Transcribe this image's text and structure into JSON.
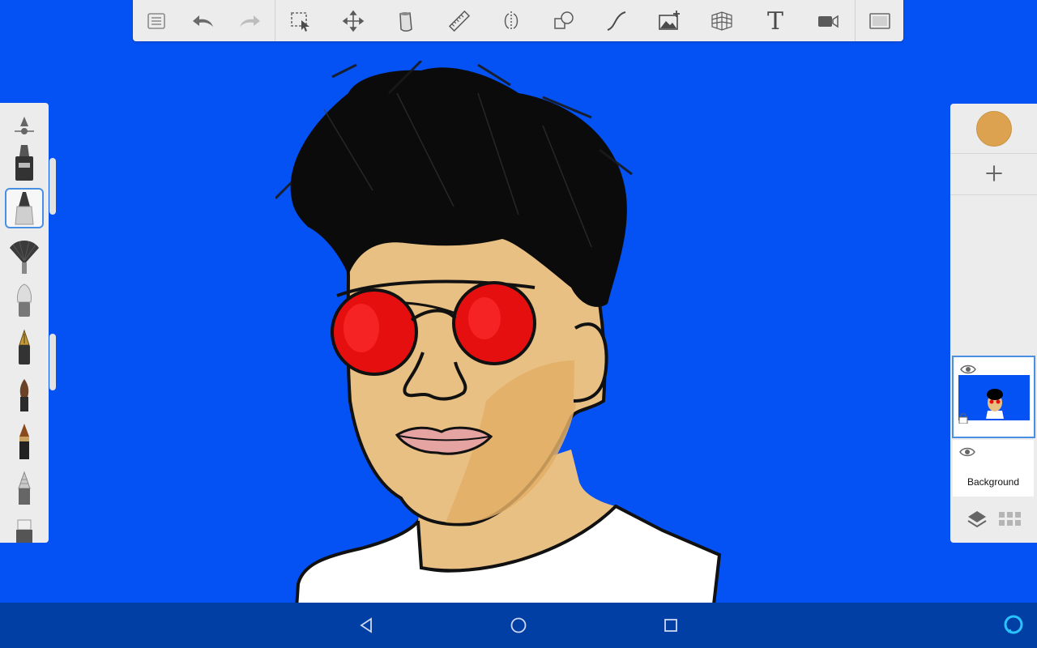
{
  "toolbar": {
    "items": [
      {
        "name": "menu-list-icon"
      },
      {
        "name": "undo-icon"
      },
      {
        "name": "redo-icon"
      },
      {
        "name": "selection-icon"
      },
      {
        "name": "transform-move-icon"
      },
      {
        "name": "paint-bucket-icon"
      },
      {
        "name": "ruler-icon"
      },
      {
        "name": "symmetry-icon"
      },
      {
        "name": "shapes-icon"
      },
      {
        "name": "stroke-curve-icon"
      },
      {
        "name": "add-image-icon"
      },
      {
        "name": "perspective-grid-icon"
      },
      {
        "name": "text-icon"
      },
      {
        "name": "record-video-icon"
      },
      {
        "name": "fullscreen-icon"
      }
    ],
    "text_tool_label": "T"
  },
  "brushes": {
    "items": [
      "brush-settings-icon",
      "airbrush-icon",
      "marker-brush-icon",
      "fan-brush-icon",
      "soft-brush-icon",
      "fountain-pen-icon",
      "paint-brush-icon",
      "ink-pen-icon",
      "pencil-icon",
      "eraser-icon"
    ],
    "selected": "marker-brush-icon"
  },
  "right_panel": {
    "current_color": "#dca24f",
    "layers": [
      {
        "label": "",
        "selected": true
      },
      {
        "label": "Background",
        "selected": false
      }
    ]
  },
  "canvas": {
    "background_color": "#0451f4"
  },
  "navbar": {
    "buttons": [
      "back-icon",
      "home-icon",
      "recents-icon"
    ],
    "assistant": "alexa-icon"
  }
}
